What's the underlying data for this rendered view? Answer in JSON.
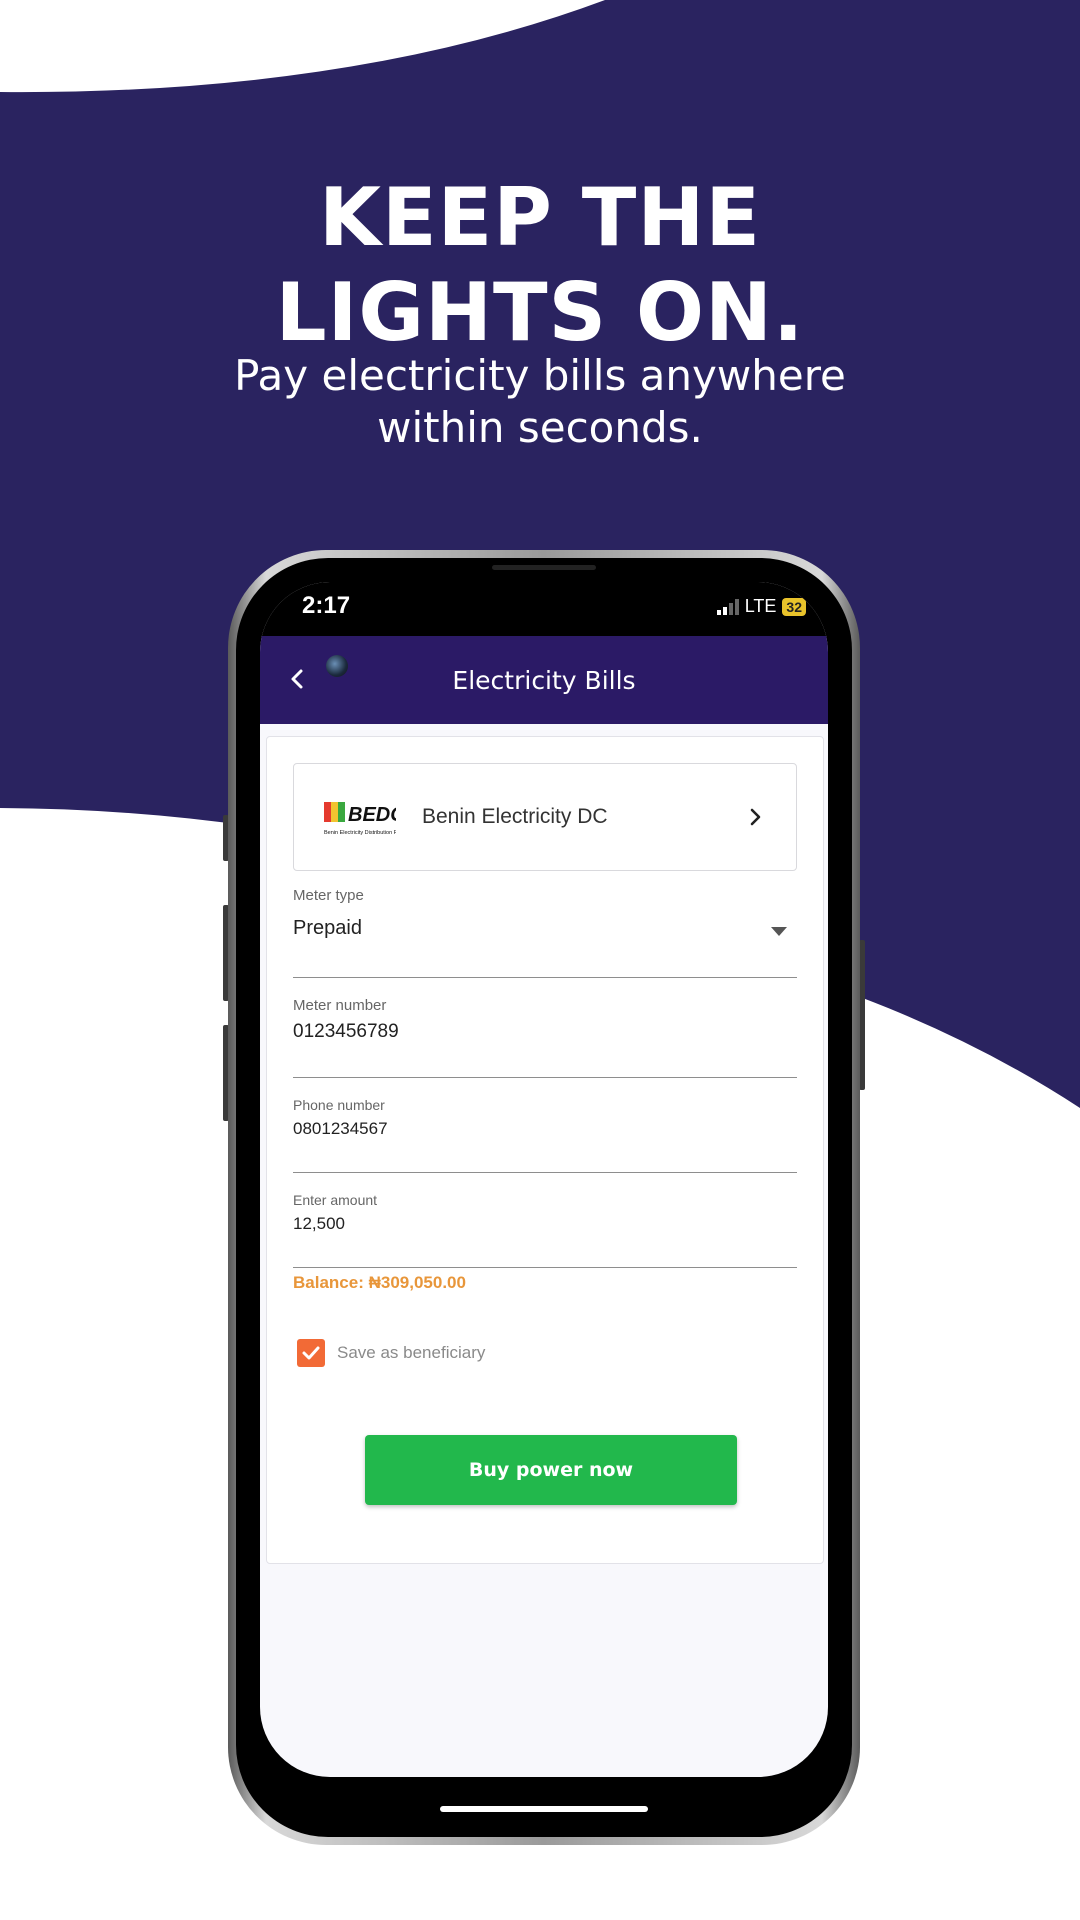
{
  "hero": {
    "headline": "KEEP THE\nLIGHTS ON.",
    "subline": "Pay electricity bills anywhere\nwithin seconds."
  },
  "colors": {
    "brand_navy": "#2a2360",
    "appbar": "#2b1a66",
    "balance": "#e8963a",
    "checkbox": "#f26a36",
    "button": "#22b84c"
  },
  "status_bar": {
    "time": "2:17",
    "network": "LTE",
    "battery": "32"
  },
  "appbar": {
    "title": "Electricity Bills",
    "back_icon": "chevron-left-icon"
  },
  "provider": {
    "logo_text": "BEDC",
    "logo_subtext": "Benin Electricity Distribution PLC",
    "name": "Benin Electricity DC"
  },
  "form": {
    "meter_type": {
      "label": "Meter type",
      "value": "Prepaid"
    },
    "meter_number": {
      "label": "Meter number",
      "value": "0123456789"
    },
    "phone_number": {
      "label": "Phone number",
      "value": "0801234567"
    },
    "amount": {
      "label": "Enter amount",
      "value": "12,500"
    }
  },
  "balance": "Balance: ₦309,050.00",
  "save_beneficiary": {
    "label": "Save as beneficiary",
    "checked": true
  },
  "buy_button": "Buy power now"
}
